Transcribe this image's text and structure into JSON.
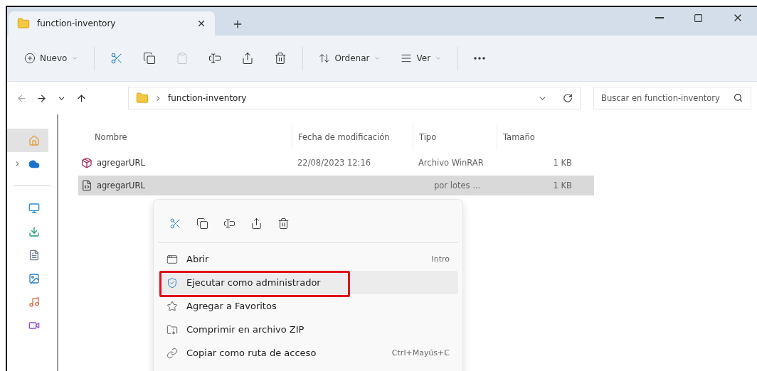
{
  "tabs": [
    {
      "label": "function-inventory",
      "selected": true
    }
  ],
  "toolbar": {
    "new_label": "Nuevo",
    "sort_label": "Ordenar",
    "view_label": "Ver",
    "actions": [
      {
        "kind": "cut",
        "disabled": false
      },
      {
        "kind": "copy",
        "disabled": false
      },
      {
        "kind": "paste",
        "disabled": true
      },
      {
        "kind": "rename",
        "disabled": false
      },
      {
        "kind": "share",
        "disabled": false
      },
      {
        "kind": "delete",
        "disabled": false
      }
    ]
  },
  "address": {
    "path": [
      "function-inventory"
    ]
  },
  "search": {
    "placeholder": "Buscar en function-inventory"
  },
  "sidebar": {
    "items": [
      {
        "kind": "home",
        "selected": true
      },
      {
        "kind": "cloud",
        "selected": false
      }
    ],
    "pinned": [
      {
        "kind": "desktop",
        "selected": false
      },
      {
        "kind": "downloads",
        "selected": false
      },
      {
        "kind": "documents",
        "selected": false
      },
      {
        "kind": "pictures",
        "selected": false
      },
      {
        "kind": "music",
        "selected": false
      },
      {
        "kind": "videos",
        "selected": false
      }
    ]
  },
  "table": {
    "columns": [
      "Nombre",
      "Fecha de modificación",
      "Tipo",
      "Tamaño"
    ],
    "rows": [
      {
        "kind": "archive",
        "name": "agregarURL",
        "modified": "22/08/2023 12:16",
        "type": "Archivo WinRAR",
        "size": "1 KB",
        "selected": false
      },
      {
        "kind": "batch",
        "name": "agregarURL",
        "type": "por lotes ...",
        "size": "1 KB",
        "selected": true
      }
    ]
  },
  "context_menu": {
    "actions": [
      {
        "kind": "cut"
      },
      {
        "kind": "copy"
      },
      {
        "kind": "rename"
      },
      {
        "kind": "share"
      },
      {
        "kind": "delete"
      }
    ],
    "items": [
      {
        "kind": "open",
        "label": "Abrir",
        "shortcut": "Intro",
        "highlighted": false
      },
      {
        "kind": "admin",
        "label": "Ejecutar como administrador",
        "highlighted": true
      },
      {
        "kind": "favorite",
        "label": "Agregar a Favoritos",
        "highlighted": false
      },
      {
        "kind": "zip",
        "label": "Comprimir en archivo ZIP",
        "highlighted": false
      },
      {
        "kind": "path",
        "label": "Copiar como ruta de acceso",
        "shortcut": "Ctrl+Mayús+C",
        "highlighted": false
      }
    ]
  }
}
